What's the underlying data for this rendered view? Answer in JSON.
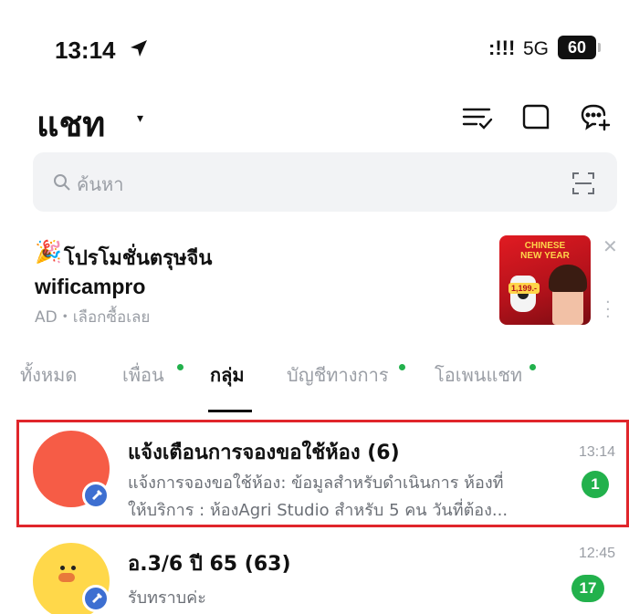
{
  "status_bar": {
    "time": "13:14",
    "signal": ":!!!",
    "network": "5G",
    "battery": "60"
  },
  "header": {
    "title": "แชท",
    "caret": "▾",
    "icons": [
      "filter-list-icon",
      "square-icon",
      "new-chat-icon"
    ]
  },
  "search": {
    "placeholder": "ค้นหา"
  },
  "ad": {
    "emoji": "🎉",
    "title": "โปรโมชั่นตรุษจีน",
    "brand": "wificampro",
    "subtitle": "AD・เลือกซื้อเลย",
    "image_lines": [
      "CHINESE",
      "NEW YEAR"
    ],
    "image_price": "1,199.-"
  },
  "tabs": [
    {
      "label": "ทั้งหมด",
      "active": false,
      "dot": false
    },
    {
      "label": "เพื่อน",
      "active": false,
      "dot": true
    },
    {
      "label": "กลุ่ม",
      "active": true,
      "dot": false
    },
    {
      "label": "บัญชีทางการ",
      "active": false,
      "dot": true
    },
    {
      "label": "โอเพนแชท",
      "active": false,
      "dot": true
    }
  ],
  "chats": [
    {
      "name": "แจ้งเตือนการจองขอใช้ห้อง (6)",
      "line1": "แจ้งการจองขอใช้ห้อง: ข้อมูลสำหรับดำเนินการ  ห้องที่",
      "line2": "ให้บริการ : ห้องAgri Studio สำหรับ 5 คน  วันที่ต้อง...",
      "time": "13:14",
      "unread": "1",
      "highlighted": true,
      "avatar_color": "#f65c46"
    },
    {
      "name": "อ.3/6 ปี 65 (63)",
      "line1": "รับทราบค่ะ",
      "time": "12:45",
      "unread": "17",
      "avatar_color": "#ffd84a"
    }
  ],
  "colors": {
    "accent_green": "#22b14c",
    "highlight_red": "#e0262b",
    "pin_blue": "#3d6fd1"
  }
}
